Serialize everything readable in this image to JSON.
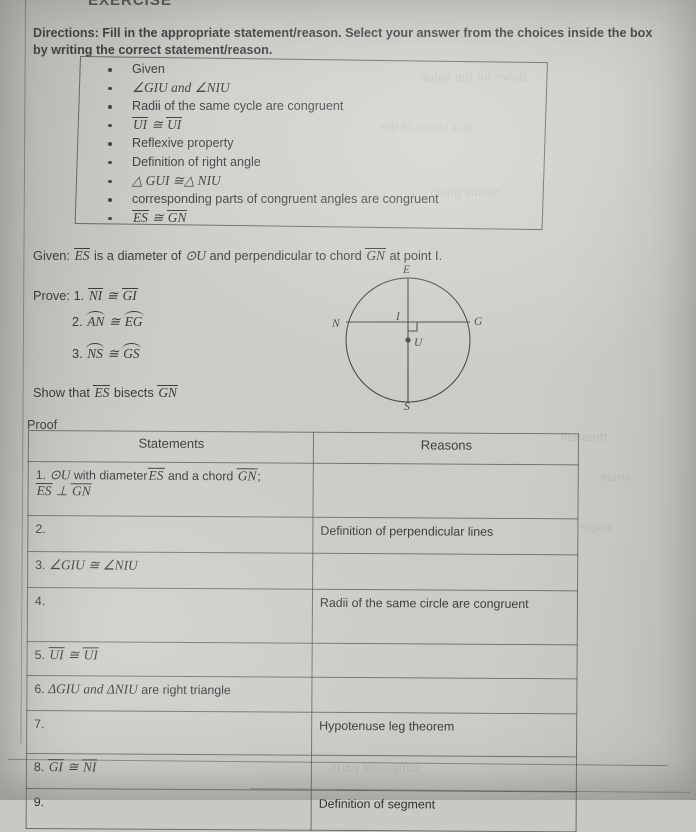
{
  "page": {
    "exercise_title": "EXERCISE",
    "directions": "Directions: Fill in the appropriate statement/reason. Select your answer from the choices inside the box by writing the correct statement/reason."
  },
  "choices": {
    "items": [
      {
        "text": "Given",
        "math": false
      },
      {
        "text": "∠GIU and ∠NIU",
        "math": true
      },
      {
        "text": "Radii of the same cycle are congruent",
        "math": false
      },
      {
        "text": "UI ≅ UI",
        "math": true
      },
      {
        "text": "Reflexive property",
        "math": false
      },
      {
        "text": "Definition of right angle",
        "math": false
      },
      {
        "text": "△ GUI ≅△ NIU",
        "math": true
      },
      {
        "text": "corresponding parts of congruent angles are congruent",
        "math": false
      },
      {
        "text": "ES ≅ GN",
        "math": true
      }
    ]
  },
  "given": {
    "label": "Given:",
    "segment": "ES",
    "mid_text": "is a diameter of",
    "circle_symbol": "⊙U",
    "tail_text": "and perpendicular to chord",
    "chord": "GN",
    "end_text": "at point I."
  },
  "prove": {
    "label": "Prove:",
    "items": [
      {
        "number": "1.",
        "left": "NI",
        "rel": "≅",
        "right": "GI",
        "kind": "segment"
      },
      {
        "number": "2.",
        "left": "AN",
        "rel": "≅",
        "right": "EG",
        "kind": "arc"
      },
      {
        "number": "3.",
        "left": "NS",
        "rel": "≅",
        "right": "GS",
        "kind": "arc"
      }
    ]
  },
  "show_that": {
    "prefix": "Show that",
    "segment": "ES",
    "verb": "bisects",
    "chord": "GN"
  },
  "diagram": {
    "labels": {
      "top": "E",
      "bottom": "S",
      "left": "N",
      "right": "G",
      "center": "U",
      "intersection": "I"
    },
    "right_angle_marker": true
  },
  "proof": {
    "label": "Proof",
    "headers": {
      "statements": "Statements",
      "reasons": "Reasons"
    },
    "rows": [
      {
        "number": "1.",
        "statement_parts": {
          "circle": "⊙U",
          "text1": "with diameter",
          "seg1": "ES",
          "text2": "and a chord",
          "seg2": "GN",
          "semi": ";",
          "line2_a": "ES",
          "perp": "⊥",
          "line2_b": "GN"
        },
        "statement_kind": "row1",
        "reason": ""
      },
      {
        "number": "2.",
        "statement_kind": "blank",
        "statement": "",
        "reason": "Definition of perpendicular lines"
      },
      {
        "number": "3.",
        "statement_kind": "angles",
        "statement": "∠GIU ≅ ∠NIU",
        "reason": ""
      },
      {
        "number": "4.",
        "statement_kind": "blank",
        "statement": "",
        "reason": "Radii of the same circle are congruent"
      },
      {
        "number": "5.",
        "statement_kind": "seg_pair",
        "seg_left": "UI",
        "seg_right": "UI",
        "reason": ""
      },
      {
        "number": "6.",
        "statement_kind": "triangles",
        "tri1": "ΔGIU",
        "conj": "and",
        "tri2": "ΔNIU",
        "tail": "are right triangle",
        "reason": ""
      },
      {
        "number": "7.",
        "statement_kind": "blank",
        "statement": "",
        "reason": "Hypotenuse leg theorem"
      },
      {
        "number": "8.",
        "statement_kind": "seg_pair",
        "seg_left": "GI",
        "seg_right": "NI",
        "reason": ""
      },
      {
        "number": "9.",
        "statement_kind": "blank",
        "statement": "",
        "reason": "Definition of segment"
      }
    ]
  },
  "colors": {
    "paper": "#c9c9c4",
    "ink": "#313133",
    "rule": "#48484a"
  }
}
